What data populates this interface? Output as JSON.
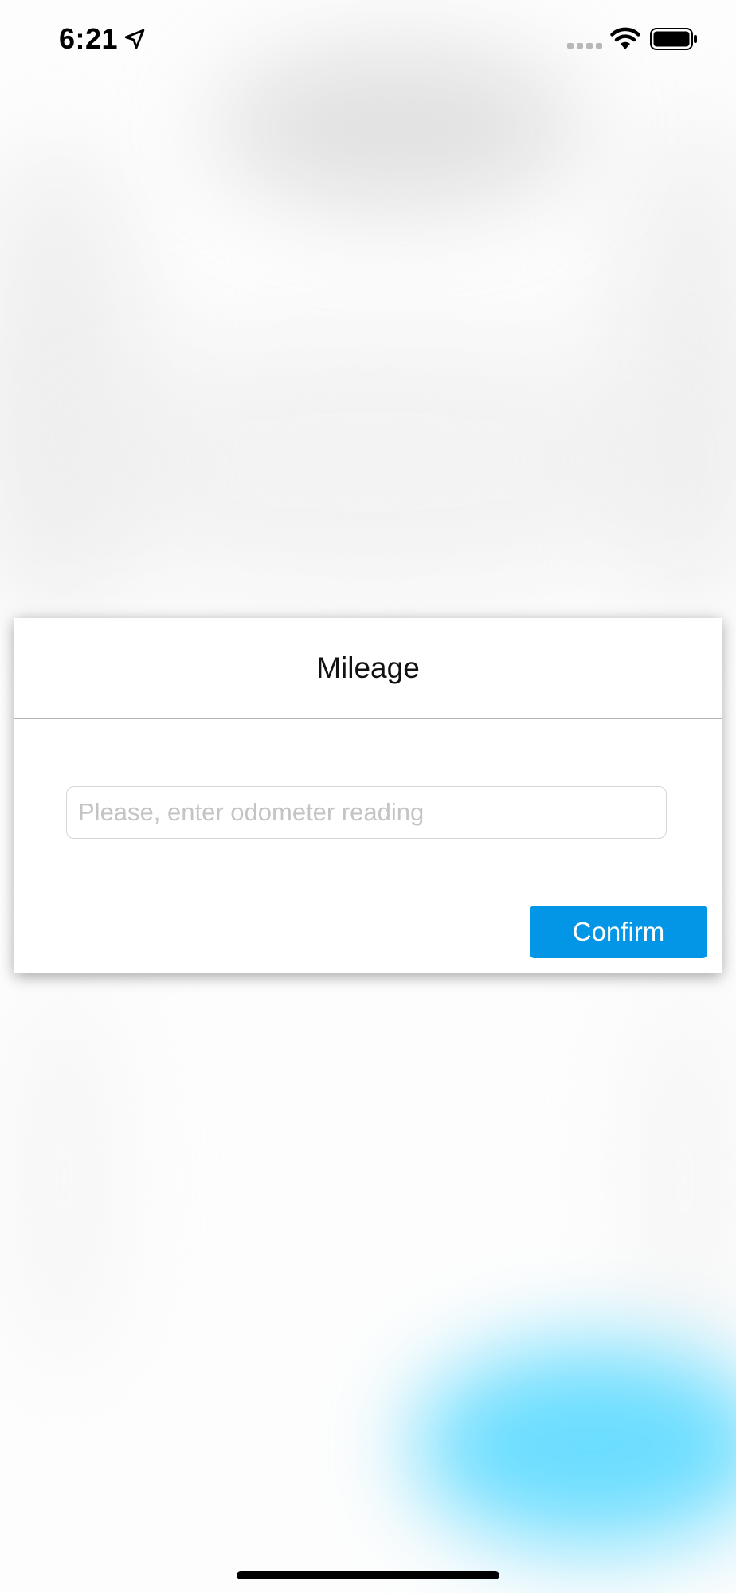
{
  "status_bar": {
    "time": "6:21",
    "icons": [
      "location-arrow-icon",
      "cellular-signal-icon",
      "wifi-icon",
      "battery-icon"
    ]
  },
  "modal": {
    "title": "Mileage",
    "odometer_input": {
      "value": "",
      "placeholder": "Please, enter odometer reading"
    },
    "confirm_label": "Confirm"
  },
  "colors": {
    "accent": "#0496e6",
    "background_glow": "#50d7ff",
    "placeholder": "#c4c4c6",
    "divider": "#b5b5b5"
  }
}
